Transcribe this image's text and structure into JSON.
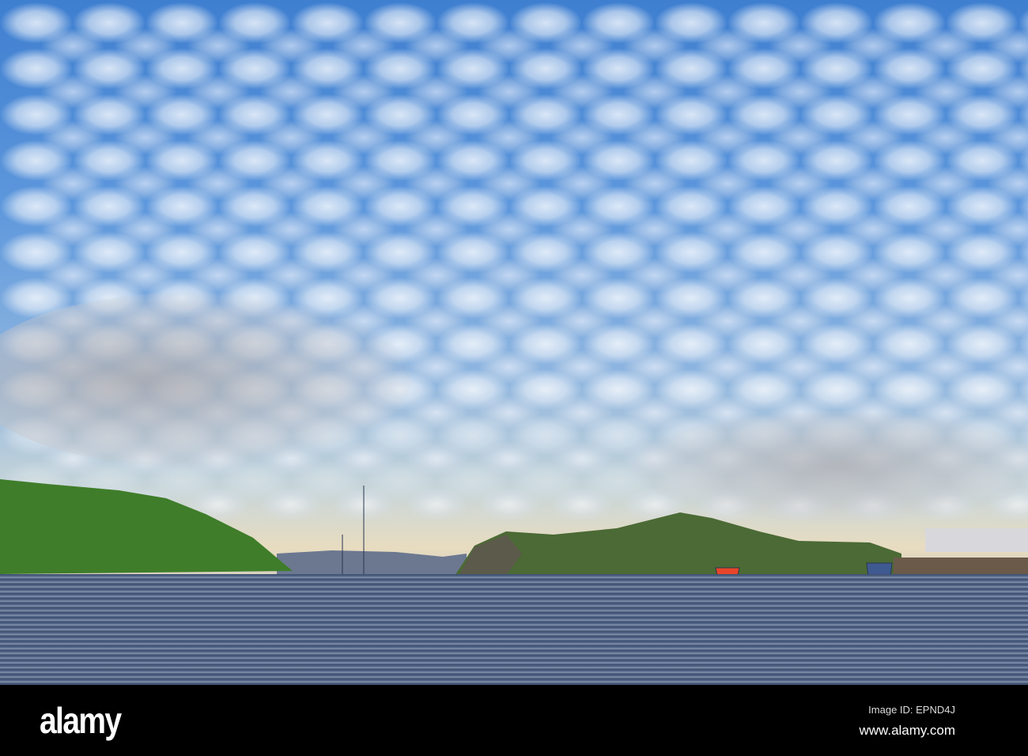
{
  "photo": {
    "subject": "harbour"
  },
  "watermark": {
    "logo": "alamy",
    "image_id": "Image ID: EPND4J",
    "website": "www.alamy.com"
  },
  "colors": {
    "sky": "#5d97dc",
    "hill": "#3f7d2a",
    "water": "#46597a",
    "footer": "#000000"
  }
}
